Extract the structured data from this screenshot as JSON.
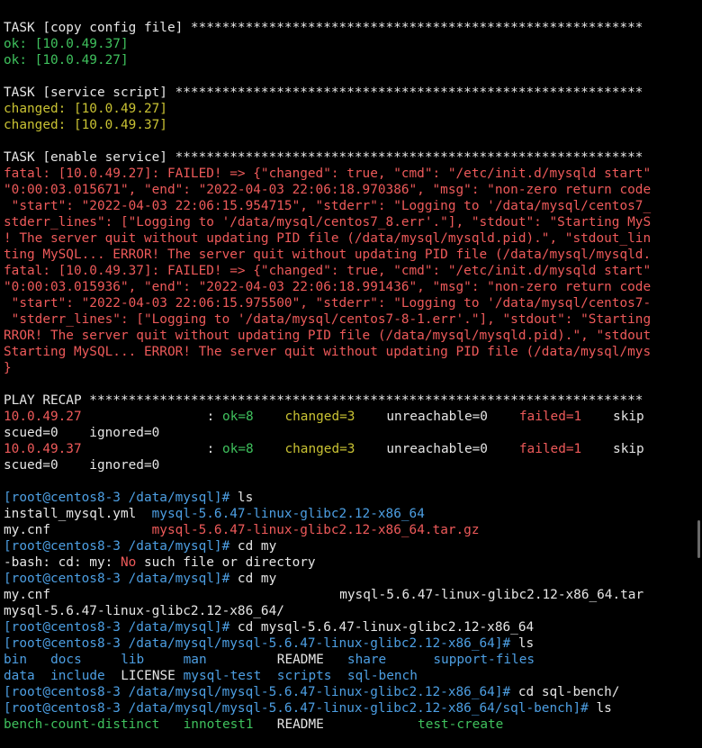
{
  "colors": {
    "default": "#e6e6e6",
    "green": "#3fc15d",
    "yellow": "#c9c233",
    "red": "#ee5a5a",
    "blue": "#4d9fe3",
    "cyan": "#36c7c2"
  },
  "lines": [
    {
      "segs": [
        {
          "t": "TASK [copy config file] **********************************************************",
          "c": "default"
        }
      ]
    },
    {
      "segs": [
        {
          "t": "ok: [10.0.49.37]",
          "c": "green"
        }
      ]
    },
    {
      "segs": [
        {
          "t": "ok: [10.0.49.27]",
          "c": "green"
        }
      ]
    },
    {
      "segs": []
    },
    {
      "segs": [
        {
          "t": "TASK [service script] ************************************************************",
          "c": "default"
        }
      ]
    },
    {
      "segs": [
        {
          "t": "changed: [10.0.49.27]",
          "c": "yellow"
        }
      ]
    },
    {
      "segs": [
        {
          "t": "changed: [10.0.49.37]",
          "c": "yellow"
        }
      ]
    },
    {
      "segs": []
    },
    {
      "segs": [
        {
          "t": "TASK [enable service] ************************************************************",
          "c": "default"
        }
      ]
    },
    {
      "segs": [
        {
          "t": "fatal: [10.0.49.27]: FAILED! => {\"changed\": true, \"cmd\": \"/etc/init.d/mysqld start\"",
          "c": "red"
        }
      ]
    },
    {
      "segs": [
        {
          "t": "\"0:00:03.015671\", \"end\": \"2022-04-03 22:06:18.970386\", \"msg\": \"non-zero return code",
          "c": "red"
        }
      ]
    },
    {
      "segs": [
        {
          "t": " \"start\": \"2022-04-03 22:06:15.954715\", \"stderr\": \"Logging to '/data/mysql/centos7_",
          "c": "red"
        }
      ]
    },
    {
      "segs": [
        {
          "t": "stderr_lines\": [\"Logging to '/data/mysql/centos7_8.err'.\"], \"stdout\": \"Starting MyS",
          "c": "red"
        }
      ]
    },
    {
      "segs": [
        {
          "t": "! The server quit without updating PID file (/data/mysql/mysqld.pid).\", \"stdout_lin",
          "c": "red"
        }
      ]
    },
    {
      "segs": [
        {
          "t": "ting MySQL... ERROR! The server quit without updating PID file (/data/mysql/mysqld.",
          "c": "red"
        }
      ]
    },
    {
      "segs": [
        {
          "t": "fatal: [10.0.49.37]: FAILED! => {\"changed\": true, \"cmd\": \"/etc/init.d/mysqld start\"",
          "c": "red"
        }
      ]
    },
    {
      "segs": [
        {
          "t": "\"0:00:03.015936\", \"end\": \"2022-04-03 22:06:18.991436\", \"msg\": \"non-zero return code",
          "c": "red"
        }
      ]
    },
    {
      "segs": [
        {
          "t": " \"start\": \"2022-04-03 22:06:15.975500\", \"stderr\": \"Logging to '/data/mysql/centos7-",
          "c": "red"
        }
      ]
    },
    {
      "segs": [
        {
          "t": " \"stderr_lines\": [\"Logging to '/data/mysql/centos7-8-1.err'.\"], \"stdout\": \"Starting",
          "c": "red"
        }
      ]
    },
    {
      "segs": [
        {
          "t": "RROR! The server quit without updating PID file (/data/mysql/mysqld.pid).\", \"stdout",
          "c": "red"
        }
      ]
    },
    {
      "segs": [
        {
          "t": "Starting MySQL... ERROR! The server quit without updating PID file (/data/mysql/mys",
          "c": "red"
        }
      ]
    },
    {
      "segs": [
        {
          "t": "}",
          "c": "red"
        }
      ]
    },
    {
      "segs": []
    },
    {
      "segs": [
        {
          "t": "PLAY RECAP ***********************************************************************",
          "c": "default"
        }
      ]
    },
    {
      "segs": [
        {
          "t": "10.0.49.27",
          "c": "red",
          "col": 0
        },
        {
          "t": ":",
          "c": "default",
          "col": 26
        },
        {
          "t": "ok=8",
          "c": "green",
          "col": 28
        },
        {
          "t": "changed=3",
          "c": "yellow",
          "col": 36
        },
        {
          "t": "unreachable=0",
          "c": "default",
          "col": 49
        },
        {
          "t": "failed=1",
          "c": "red",
          "col": 66
        },
        {
          "t": "skip",
          "c": "default",
          "col": 78
        }
      ]
    },
    {
      "segs": [
        {
          "t": "scued=0    ignored=0",
          "c": "default"
        }
      ]
    },
    {
      "segs": [
        {
          "t": "10.0.49.37",
          "c": "red",
          "col": 0
        },
        {
          "t": ":",
          "c": "default",
          "col": 26
        },
        {
          "t": "ok=8",
          "c": "green",
          "col": 28
        },
        {
          "t": "changed=3",
          "c": "yellow",
          "col": 36
        },
        {
          "t": "unreachable=0",
          "c": "default",
          "col": 49
        },
        {
          "t": "failed=1",
          "c": "red",
          "col": 66
        },
        {
          "t": "skip",
          "c": "default",
          "col": 78
        }
      ]
    },
    {
      "segs": [
        {
          "t": "scued=0    ignored=0",
          "c": "default"
        }
      ]
    },
    {
      "segs": []
    },
    {
      "segs": [
        {
          "t": "[root@centos8-3 /data/mysql]# ",
          "c": "blue"
        },
        {
          "t": "ls",
          "c": "default"
        }
      ]
    },
    {
      "segs": [
        {
          "t": "install_mysql.yml  ",
          "c": "default"
        },
        {
          "t": "mysql-5.6.47-linux-glibc2.12-x86_64",
          "c": "blue"
        }
      ]
    },
    {
      "segs": [
        {
          "t": "my.cnf             ",
          "c": "default"
        },
        {
          "t": "mysql-5.6.47-linux-glibc2.12-x86_64.tar.gz",
          "c": "red"
        }
      ]
    },
    {
      "segs": [
        {
          "t": "[root@centos8-3 /data/mysql]# ",
          "c": "blue"
        },
        {
          "t": "cd my",
          "c": "default"
        }
      ]
    },
    {
      "segs": [
        {
          "t": "-bash: cd: my: ",
          "c": "default"
        },
        {
          "t": "No",
          "c": "red"
        },
        {
          "t": " such file or directory",
          "c": "default"
        }
      ]
    },
    {
      "segs": [
        {
          "t": "[root@centos8-3 /data/mysql]# ",
          "c": "blue"
        },
        {
          "t": "cd my",
          "c": "default"
        }
      ]
    },
    {
      "segs": [
        {
          "t": "my.cnf",
          "c": "default",
          "col": 0
        },
        {
          "t": "mysql-5.6.47-linux-glibc2.12-x86_64.tar",
          "c": "default",
          "col": 43
        }
      ]
    },
    {
      "segs": [
        {
          "t": "mysql-5.6.47-linux-glibc2.12-x86_64/",
          "c": "default"
        }
      ]
    },
    {
      "segs": [
        {
          "t": "[root@centos8-3 /data/mysql]# ",
          "c": "blue"
        },
        {
          "t": "cd mysql-5.6.47-linux-glibc2.12-x86_64",
          "c": "default"
        }
      ]
    },
    {
      "segs": [
        {
          "t": "[root@centos8-3 /data/mysql/mysql-5.6.47-linux-glibc2.12-x86_64]# ",
          "c": "blue"
        },
        {
          "t": "ls",
          "c": "default"
        }
      ]
    },
    {
      "segs": [
        {
          "t": "bin",
          "c": "blue",
          "col": 0
        },
        {
          "t": "docs",
          "c": "blue",
          "col": 6
        },
        {
          "t": "lib",
          "c": "blue",
          "col": 15
        },
        {
          "t": "man",
          "c": "blue",
          "col": 23
        },
        {
          "t": "README",
          "c": "default",
          "col": 35
        },
        {
          "t": "share",
          "c": "blue",
          "col": 44
        },
        {
          "t": "support-files",
          "c": "blue",
          "col": 55
        }
      ]
    },
    {
      "segs": [
        {
          "t": "data",
          "c": "blue",
          "col": 0
        },
        {
          "t": "include",
          "c": "blue",
          "col": 6
        },
        {
          "t": "LICENSE",
          "c": "default",
          "col": 15
        },
        {
          "t": "mysql-test",
          "c": "blue",
          "col": 23
        },
        {
          "t": "scripts",
          "c": "blue",
          "col": 35
        },
        {
          "t": "sql-bench",
          "c": "blue",
          "col": 44
        }
      ]
    },
    {
      "segs": [
        {
          "t": "[root@centos8-3 /data/mysql/mysql-5.6.47-linux-glibc2.12-x86_64]# ",
          "c": "blue"
        },
        {
          "t": "cd sql-bench/",
          "c": "default"
        }
      ]
    },
    {
      "segs": [
        {
          "t": "[root@centos8-3 /data/mysql/mysql-5.6.47-linux-glibc2.12-x86_64/sql-bench]# ",
          "c": "blue"
        },
        {
          "t": "ls",
          "c": "default"
        }
      ]
    },
    {
      "segs": [
        {
          "t": "bench-count-distinct",
          "c": "green",
          "col": 0
        },
        {
          "t": "innotest1",
          "c": "green",
          "col": 23
        },
        {
          "t": "README",
          "c": "default",
          "col": 35
        },
        {
          "t": "test-create",
          "c": "green",
          "col": 53
        }
      ]
    }
  ]
}
